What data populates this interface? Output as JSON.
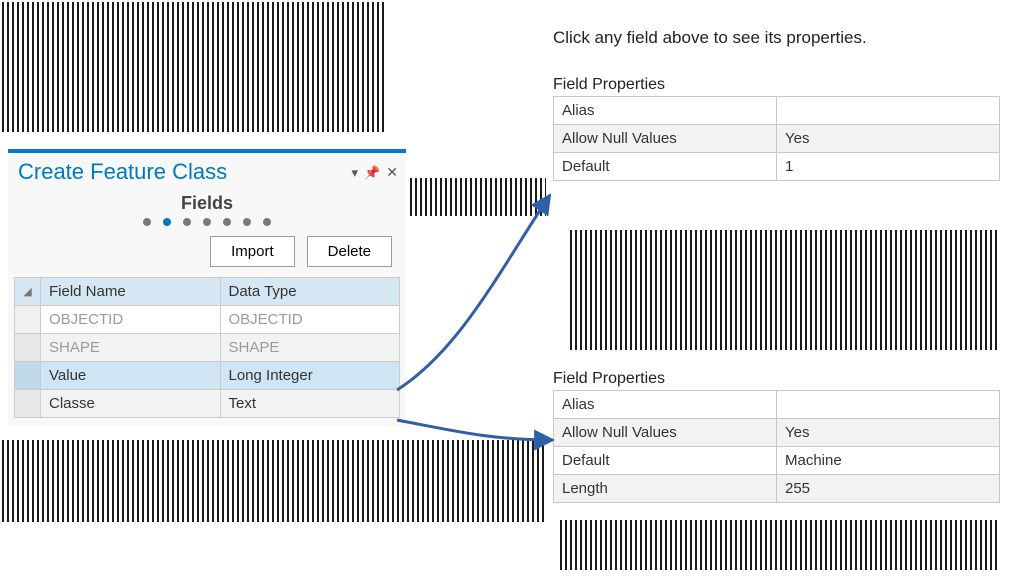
{
  "dialog": {
    "title": "Create Feature Class",
    "section_heading": "Fields",
    "step_count": 7,
    "step_active_index": 1,
    "buttons": {
      "import": "Import",
      "delete": "Delete"
    },
    "grid": {
      "headers": {
        "name": "Field Name",
        "type": "Data Type"
      },
      "rows": [
        {
          "name": "OBJECTID",
          "type": "OBJECTID",
          "readonly": true,
          "selected": false,
          "alt": false
        },
        {
          "name": "SHAPE",
          "type": "SHAPE",
          "readonly": true,
          "selected": false,
          "alt": true
        },
        {
          "name": "Value",
          "type": "Long Integer",
          "readonly": false,
          "selected": true,
          "alt": false
        },
        {
          "name": "Classe",
          "type": "Text",
          "readonly": false,
          "selected": false,
          "alt": true
        }
      ]
    }
  },
  "instruction_text": "Click any field above to see its properties.",
  "props_top": {
    "title": "Field Properties",
    "rows": [
      {
        "key": "Alias",
        "value": "",
        "alt": false
      },
      {
        "key": "Allow Null Values",
        "value": "Yes",
        "alt": true
      },
      {
        "key": "Default",
        "value": "1",
        "alt": false
      }
    ]
  },
  "props_bottom": {
    "title": "Field Properties",
    "rows": [
      {
        "key": "Alias",
        "value": "",
        "alt": false
      },
      {
        "key": "Allow Null Values",
        "value": "Yes",
        "alt": true
      },
      {
        "key": "Default",
        "value": "Machine",
        "alt": false
      },
      {
        "key": "Length",
        "value": "255",
        "alt": true
      }
    ]
  }
}
